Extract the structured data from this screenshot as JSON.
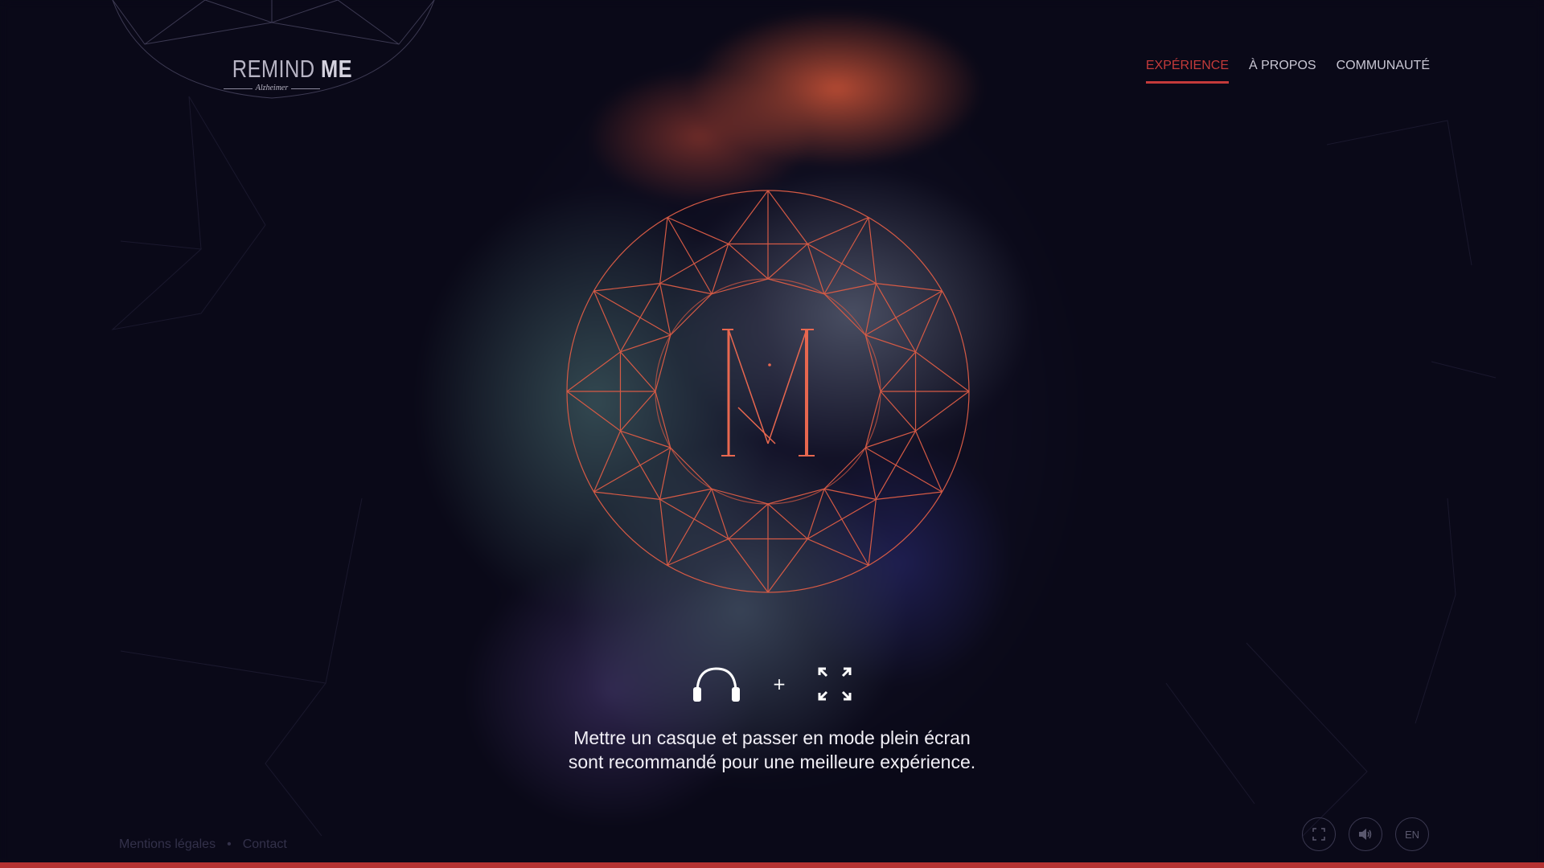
{
  "brand": {
    "name_light": "REMIND ",
    "name_bold": "ME",
    "subtitle": "Alzheimer"
  },
  "nav": {
    "items": [
      {
        "label": "EXPÉRIENCE",
        "active": true
      },
      {
        "label": "À PROPOS",
        "active": false
      },
      {
        "label": "COMMUNAUTÉ",
        "active": false
      }
    ]
  },
  "recommendation": {
    "icons": [
      "headphones-icon",
      "fullscreen-icon"
    ],
    "plus": "+",
    "line1": "Mettre un casque et passer en mode plein écran",
    "line2": "sont recommandé pour une meilleure expérience."
  },
  "footer": {
    "legal": "Mentions légales",
    "separator": "•",
    "contact": "Contact"
  },
  "controls": {
    "fullscreen_icon": "fullscreen-icon",
    "sound_icon": "speaker-icon",
    "language": "EN"
  },
  "progress": {
    "value": 1.0
  },
  "colors": {
    "accent": "#c43a3a",
    "emblem": "#e0604a",
    "background": "#0a0918"
  }
}
